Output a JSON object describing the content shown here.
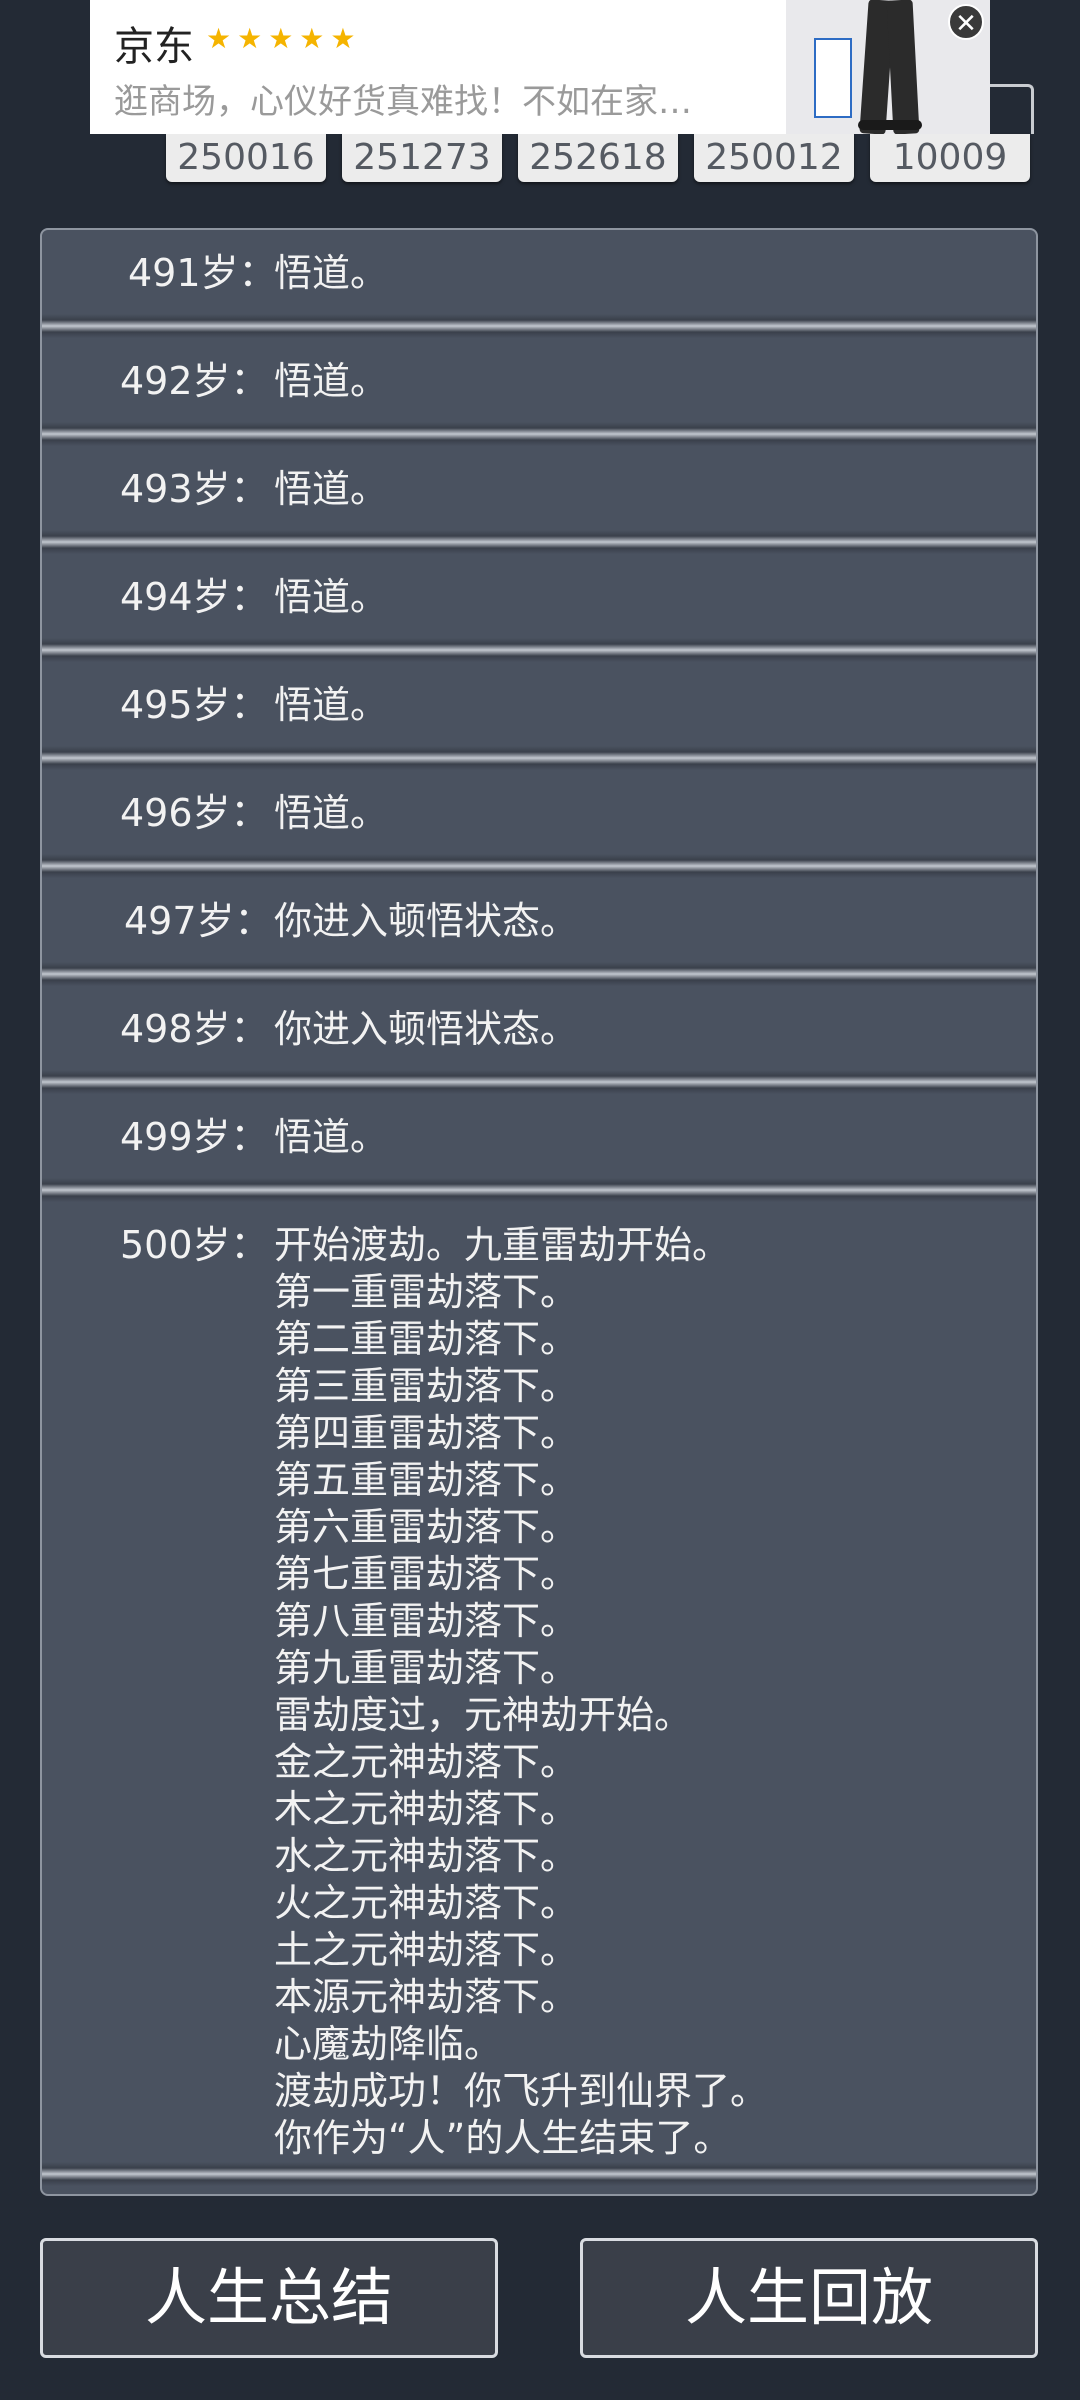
{
  "ad": {
    "brand": "京东",
    "stars": "★★★★★",
    "description": "逛商场，心仪好货真难找！不如在家…",
    "close_icon": "close-icon"
  },
  "codes": [
    "250016",
    "251273",
    "252618",
    "250012",
    "10009"
  ],
  "log": [
    {
      "age": "491岁：",
      "lines": [
        "悟道。"
      ]
    },
    {
      "age": "492岁：",
      "lines": [
        "悟道。"
      ]
    },
    {
      "age": "493岁：",
      "lines": [
        "悟道。"
      ]
    },
    {
      "age": "494岁：",
      "lines": [
        "悟道。"
      ]
    },
    {
      "age": "495岁：",
      "lines": [
        "悟道。"
      ]
    },
    {
      "age": "496岁：",
      "lines": [
        "悟道。"
      ]
    },
    {
      "age": "497岁：",
      "lines": [
        "你进入顿悟状态。"
      ]
    },
    {
      "age": "498岁：",
      "lines": [
        "你进入顿悟状态。"
      ]
    },
    {
      "age": "499岁：",
      "lines": [
        "悟道。"
      ]
    },
    {
      "age": "500岁：",
      "lines": [
        "开始渡劫。九重雷劫开始。",
        "第一重雷劫落下。",
        "第二重雷劫落下。",
        "第三重雷劫落下。",
        "第四重雷劫落下。",
        "第五重雷劫落下。",
        "第六重雷劫落下。",
        "第七重雷劫落下。",
        "第八重雷劫落下。",
        "第九重雷劫落下。",
        "雷劫度过，元神劫开始。",
        "金之元神劫落下。",
        "木之元神劫落下。",
        "水之元神劫落下。",
        "火之元神劫落下。",
        "土之元神劫落下。",
        "本源元神劫落下。",
        "心魔劫降临。",
        "渡劫成功！你飞升到仙界了。",
        "你作为“人”的人生结束了。"
      ]
    }
  ],
  "buttons": {
    "summary": "人生总结",
    "replay": "人生回放"
  }
}
